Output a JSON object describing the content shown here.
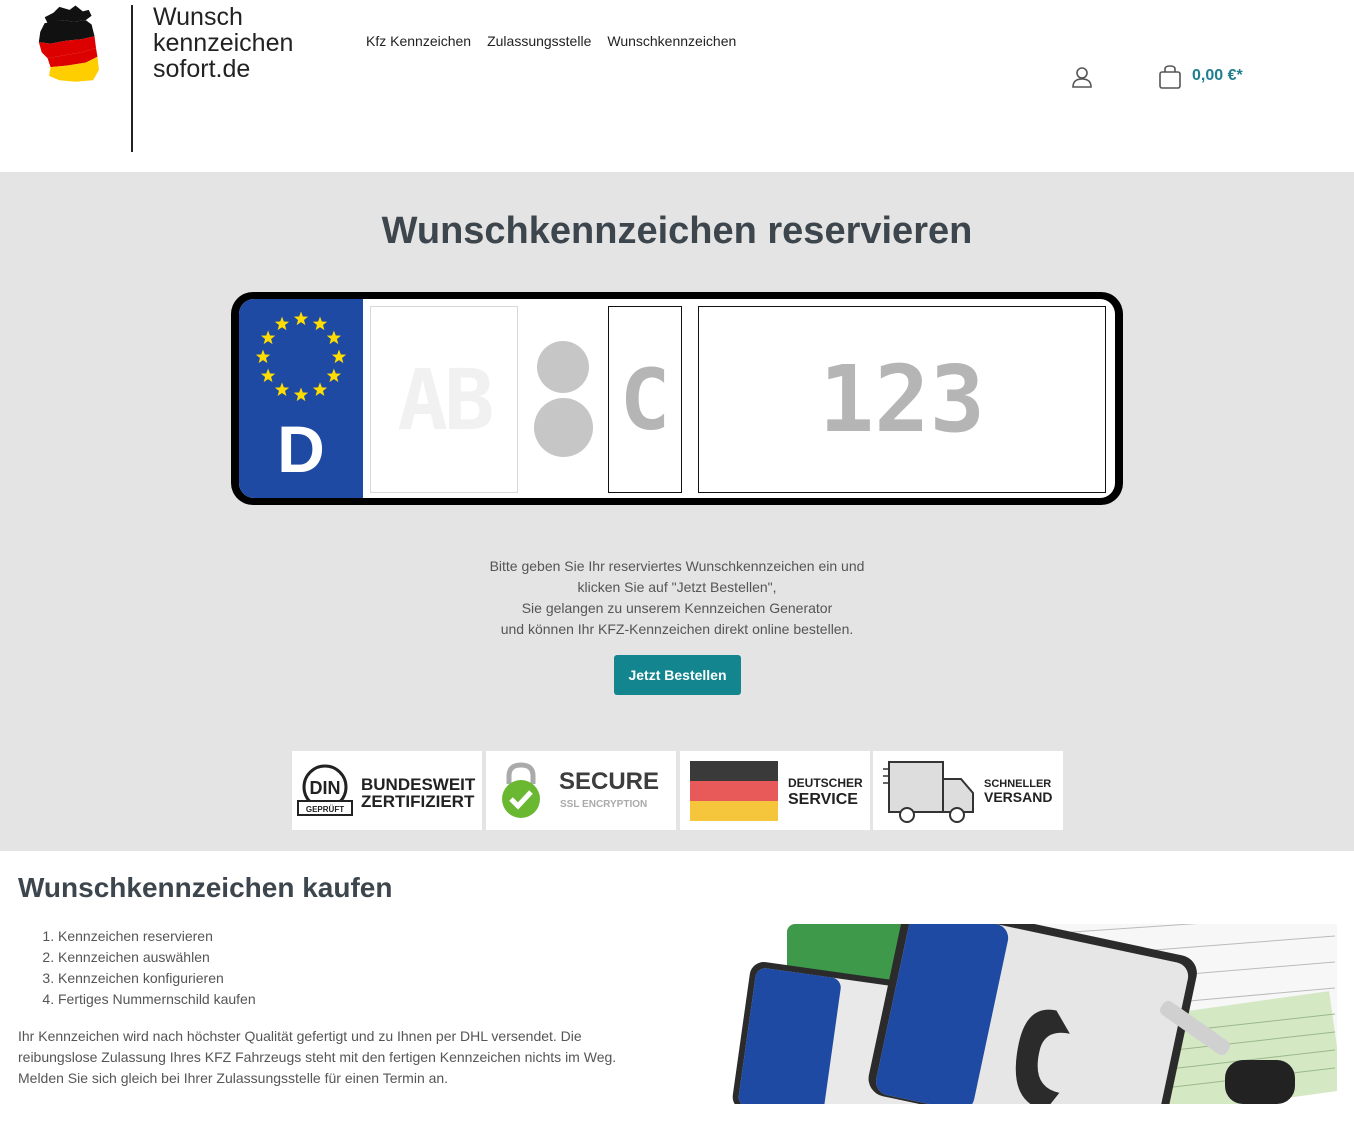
{
  "header": {
    "logo_lines": [
      "Wunsch",
      "kennzeichen",
      "sofort.de"
    ],
    "nav": [
      {
        "label": "Kfz Kennzeichen"
      },
      {
        "label": "Zulassungsstelle"
      },
      {
        "label": "Wunschkennzeichen"
      }
    ],
    "cart_total": "0,00 €*"
  },
  "hero": {
    "title": "Wunschkennzeichen reservieren",
    "plate": {
      "country": "D",
      "city_placeholder": "AB",
      "letters_placeholder": "C",
      "numbers_placeholder": "123"
    },
    "description": [
      "Bitte geben Sie Ihr reserviertes Wunschkennzeichen ein und",
      "klicken Sie auf \"Jetzt Bestellen\",",
      "Sie gelangen zu unserem Kennzeichen Generator",
      "und können Ihr KFZ-Kennzeichen direkt online bestellen."
    ],
    "order_button": "Jetzt Bestellen"
  },
  "badges": {
    "din_mark": "DIN",
    "din_sub": "GEPRÜFT",
    "din_line1": "BUNDESWEIT",
    "din_line2": "ZERTIFIZIERT",
    "secure_line1": "SECURE",
    "secure_line2": "SSL ENCRYPTION",
    "service_line1": "DEUTSCHER",
    "service_line2": "SERVICE",
    "shipping_line1": "SCHNELLER",
    "shipping_line2": "VERSAND"
  },
  "info": {
    "title": "Wunschkennzeichen kaufen",
    "steps": [
      "Kennzeichen reservieren",
      "Kennzeichen auswählen",
      "Kennzeichen konfigurieren",
      "Fertiges Nummernschild kaufen"
    ],
    "paragraph_lines": [
      "Ihr Kennzeichen wird nach höchster Qualität gefertigt und zu Ihnen per DHL versendet. Die",
      "reibungslose Zulassung Ihres KFZ Fahrzeugs steht mit den fertigen Kennzeichen nichts im Weg.",
      "Melden Sie sich gleich bei Ihrer Zulassungsstelle für einen Termin an."
    ]
  },
  "colors": {
    "accent": "#12858f",
    "cart": "#1f7f8e",
    "eu_blue": "#1f4aa3",
    "hero_bg": "#e4e4e4"
  }
}
